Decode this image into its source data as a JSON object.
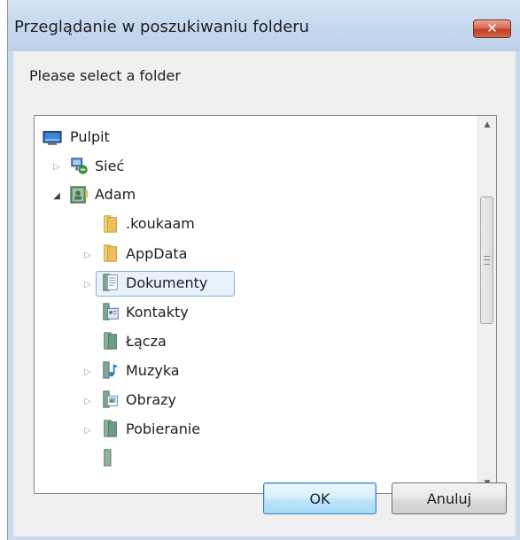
{
  "window": {
    "title": "Przeglądanie w poszukiwaniu folderu",
    "close_label": "✕"
  },
  "prompt": "Please select a folder",
  "tree": {
    "items": [
      {
        "label": "Pulpit",
        "icon": "desktop-icon",
        "expander": "none"
      },
      {
        "label": "Sieć",
        "icon": "network-icon",
        "expander": "collapsed"
      },
      {
        "label": "Adam",
        "icon": "user-folder-icon",
        "expander": "expanded"
      },
      {
        "label": ".koukaam",
        "icon": "folder-icon",
        "expander": "none"
      },
      {
        "label": "AppData",
        "icon": "folder-icon",
        "expander": "collapsed"
      },
      {
        "label": "Dokumenty",
        "icon": "documents-icon",
        "expander": "collapsed",
        "selected": true
      },
      {
        "label": "Kontakty",
        "icon": "contacts-icon",
        "expander": "none"
      },
      {
        "label": "Łącza",
        "icon": "links-icon",
        "expander": "none"
      },
      {
        "label": "Muzyka",
        "icon": "music-icon",
        "expander": "collapsed"
      },
      {
        "label": "Obrazy",
        "icon": "pictures-icon",
        "expander": "collapsed"
      },
      {
        "label": "Pobieranie",
        "icon": "downloads-icon",
        "expander": "collapsed"
      }
    ]
  },
  "scrollbar": {
    "up": "▲",
    "down": "▼"
  },
  "buttons": {
    "ok": "OK",
    "cancel": "Anuluj"
  },
  "colors": {
    "selection": "#e7f2fc",
    "selection_border": "#84acdd",
    "folder": "#e8c15a"
  }
}
